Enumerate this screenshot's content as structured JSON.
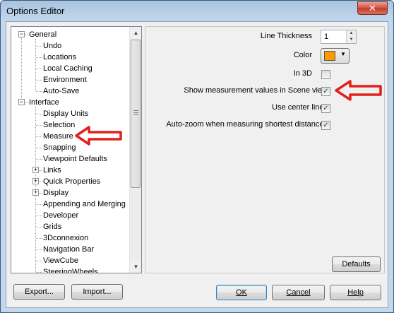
{
  "window": {
    "title": "Options Editor",
    "close_glyph": "✕"
  },
  "tree": {
    "nodes": [
      {
        "label": "General",
        "expander": "−"
      },
      {
        "label": "Undo"
      },
      {
        "label": "Locations"
      },
      {
        "label": "Local Caching"
      },
      {
        "label": "Environment"
      },
      {
        "label": "Auto-Save"
      },
      {
        "label": "Interface",
        "expander": "−"
      },
      {
        "label": "Display Units"
      },
      {
        "label": "Selection"
      },
      {
        "label": "Measure"
      },
      {
        "label": "Snapping"
      },
      {
        "label": "Viewpoint Defaults"
      },
      {
        "label": "Links",
        "expander": "+"
      },
      {
        "label": "Quick Properties",
        "expander": "+"
      },
      {
        "label": "Display",
        "expander": "+"
      },
      {
        "label": "Appending and Merging"
      },
      {
        "label": "Developer"
      },
      {
        "label": "Grids"
      },
      {
        "label": "3Dconnexion"
      },
      {
        "label": "Navigation Bar"
      },
      {
        "label": "ViewCube"
      },
      {
        "label": "SteeringWheels"
      }
    ]
  },
  "settings": {
    "line_thickness_label": "Line Thickness",
    "line_thickness_value": "1",
    "color_label": "Color",
    "color_value": "#ff9900",
    "in3d_label": "In 3D",
    "in3d_checked": false,
    "show_measurement_label": "Show measurement values in Scene view",
    "show_measurement_checked": true,
    "use_center_lines_label": "Use center lines",
    "use_center_lines_checked": true,
    "auto_zoom_label": "Auto-zoom when measuring shortest distances",
    "auto_zoom_checked": true,
    "check_glyph": "✓"
  },
  "buttons": {
    "defaults": "Defaults",
    "export": "Export...",
    "import": "Import...",
    "ok": "OK",
    "cancel": "Cancel",
    "help": "Help"
  },
  "annotation_color": "#e0201b"
}
